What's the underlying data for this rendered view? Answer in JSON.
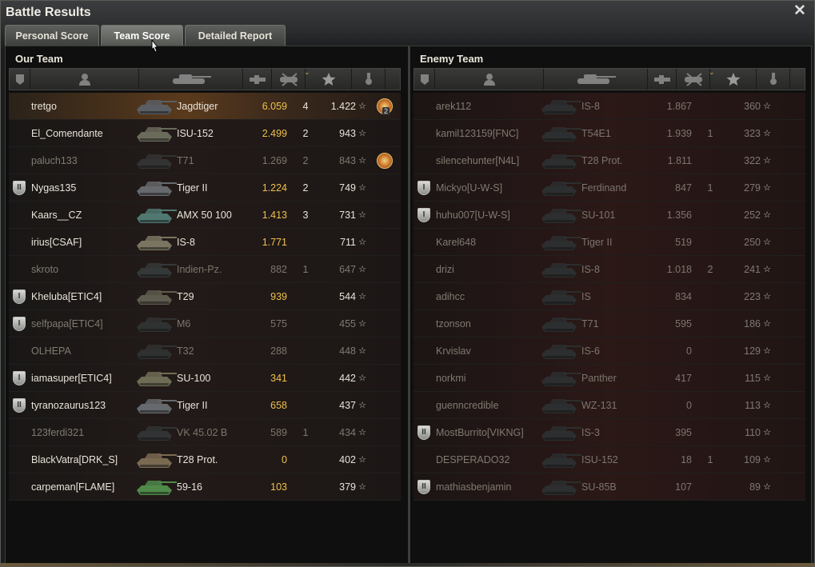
{
  "window": {
    "title": "Battle Results",
    "close_icon": "close-icon"
  },
  "tabs": [
    {
      "label": "Personal Score",
      "active": false
    },
    {
      "label": "Team Score",
      "active": true
    },
    {
      "label": "Detailed Report",
      "active": false
    }
  ],
  "columns": [
    "badge-icon",
    "player-icon",
    "vehicle-icon",
    "damage-icon",
    "kills-icon",
    "xp-star-icon",
    "achievement-icon"
  ],
  "our_team": {
    "title": "Our Team",
    "rows": [
      {
        "badge": "",
        "name": "tretgo",
        "vehicle": "Jagdtiger",
        "damage": "6.059",
        "kills": "4",
        "xp": "1.422",
        "alive": true,
        "me": true,
        "medal": true,
        "medal_count": "2",
        "tank_color": "#5a5e64"
      },
      {
        "badge": "",
        "name": "El_Comendante",
        "vehicle": "ISU-152",
        "damage": "2.499",
        "kills": "2",
        "xp": "943",
        "alive": true,
        "me": false,
        "medal": false,
        "medal_count": "",
        "tank_color": "#6a6b5a"
      },
      {
        "badge": "",
        "name": "paluch133",
        "vehicle": "T71",
        "damage": "1.269",
        "kills": "2",
        "xp": "843",
        "alive": false,
        "me": false,
        "medal": true,
        "medal_count": "",
        "tank_color": "#333"
      },
      {
        "badge": "II",
        "name": "Nygas135",
        "vehicle": "Tiger II",
        "damage": "1.224",
        "kills": "2",
        "xp": "749",
        "alive": true,
        "me": false,
        "medal": false,
        "medal_count": "",
        "tank_color": "#66696d"
      },
      {
        "badge": "",
        "name": "Kaars__CZ",
        "vehicle": "AMX 50 100",
        "damage": "1.413",
        "kills": "3",
        "xp": "731",
        "alive": true,
        "me": false,
        "medal": false,
        "medal_count": "",
        "tank_color": "#4f7870"
      },
      {
        "badge": "",
        "name": "irius[CSAF]",
        "vehicle": "IS-8",
        "damage": "1.771",
        "kills": "",
        "xp": "711",
        "alive": true,
        "me": false,
        "medal": false,
        "medal_count": "",
        "tank_color": "#7a7560"
      },
      {
        "badge": "",
        "name": "skroto",
        "vehicle": "Indien-Pz.",
        "damage": "882",
        "kills": "1",
        "xp": "647",
        "alive": false,
        "me": false,
        "medal": false,
        "medal_count": "",
        "tank_color": "#353838"
      },
      {
        "badge": "I",
        "name": "Kheluba[ETIC4]",
        "vehicle": "T29",
        "damage": "939",
        "kills": "",
        "xp": "544",
        "alive": true,
        "me": false,
        "medal": false,
        "medal_count": "",
        "tank_color": "#5e5c4e"
      },
      {
        "badge": "I",
        "name": "selfpapa[ETIC4]",
        "vehicle": "M6",
        "damage": "575",
        "kills": "",
        "xp": "455",
        "alive": false,
        "me": false,
        "medal": false,
        "medal_count": "",
        "tank_color": "#303232"
      },
      {
        "badge": "",
        "name": "OLHEPA",
        "vehicle": "T32",
        "damage": "288",
        "kills": "",
        "xp": "448",
        "alive": false,
        "me": false,
        "medal": false,
        "medal_count": "",
        "tank_color": "#2f3130"
      },
      {
        "badge": "I",
        "name": "iamasuper[ETIC4]",
        "vehicle": "SU-100",
        "damage": "341",
        "kills": "",
        "xp": "442",
        "alive": true,
        "me": false,
        "medal": false,
        "medal_count": "",
        "tank_color": "#6e6c55"
      },
      {
        "badge": "II",
        "name": "tyranozaurus123",
        "vehicle": "Tiger II",
        "damage": "658",
        "kills": "",
        "xp": "437",
        "alive": true,
        "me": false,
        "medal": false,
        "medal_count": "",
        "tank_color": "#66696d"
      },
      {
        "badge": "",
        "name": "123ferdi321",
        "vehicle": "VK 45.02 B",
        "damage": "589",
        "kills": "1",
        "xp": "434",
        "alive": false,
        "me": false,
        "medal": false,
        "medal_count": "",
        "tank_color": "#313334"
      },
      {
        "badge": "",
        "name": "BlackVatra[DRK_S]",
        "vehicle": "T28 Prot.",
        "damage": "0",
        "kills": "",
        "xp": "402",
        "alive": true,
        "me": false,
        "medal": false,
        "medal_count": "",
        "tank_color": "#7a6a52"
      },
      {
        "badge": "",
        "name": "carpeman[FLAME]",
        "vehicle": "59-16",
        "damage": "103",
        "kills": "",
        "xp": "379",
        "alive": true,
        "me": false,
        "medal": false,
        "medal_count": "",
        "tank_color": "#4f8a4a"
      }
    ]
  },
  "enemy_team": {
    "title": "Enemy Team",
    "rows": [
      {
        "badge": "",
        "name": "arek112",
        "vehicle": "IS-8",
        "damage": "1.867",
        "kills": "",
        "xp": "360",
        "alive": false
      },
      {
        "badge": "",
        "name": "kamil123159[FNC]",
        "vehicle": "T54E1",
        "damage": "1.939",
        "kills": "1",
        "xp": "323",
        "alive": false
      },
      {
        "badge": "",
        "name": "silencehunter[N4L]",
        "vehicle": "T28 Prot.",
        "damage": "1.811",
        "kills": "",
        "xp": "322",
        "alive": false
      },
      {
        "badge": "I",
        "name": "Mickyo[U-W-S]",
        "vehicle": "Ferdinand",
        "damage": "847",
        "kills": "1",
        "xp": "279",
        "alive": false
      },
      {
        "badge": "I",
        "name": "huhu007[U-W-S]",
        "vehicle": "SU-101",
        "damage": "1.356",
        "kills": "",
        "xp": "252",
        "alive": false
      },
      {
        "badge": "",
        "name": "Karel648",
        "vehicle": "Tiger II",
        "damage": "519",
        "kills": "",
        "xp": "250",
        "alive": false
      },
      {
        "badge": "",
        "name": "drizi",
        "vehicle": "IS-8",
        "damage": "1.018",
        "kills": "2",
        "xp": "241",
        "alive": false
      },
      {
        "badge": "",
        "name": "adihcc",
        "vehicle": "IS",
        "damage": "834",
        "kills": "",
        "xp": "223",
        "alive": false
      },
      {
        "badge": "",
        "name": "tzonson",
        "vehicle": "T71",
        "damage": "595",
        "kills": "",
        "xp": "186",
        "alive": false
      },
      {
        "badge": "",
        "name": "Krvislav",
        "vehicle": "IS-6",
        "damage": "0",
        "kills": "",
        "xp": "129",
        "alive": false
      },
      {
        "badge": "",
        "name": "norkmi",
        "vehicle": "Panther",
        "damage": "417",
        "kills": "",
        "xp": "115",
        "alive": false
      },
      {
        "badge": "",
        "name": "guenncredible",
        "vehicle": "WZ-131",
        "damage": "0",
        "kills": "",
        "xp": "113",
        "alive": false
      },
      {
        "badge": "II",
        "name": "MostBurrito[VIKNG]",
        "vehicle": "IS-3",
        "damage": "395",
        "kills": "",
        "xp": "110",
        "alive": false
      },
      {
        "badge": "",
        "name": "DESPERADO32",
        "vehicle": "ISU-152",
        "damage": "18",
        "kills": "1",
        "xp": "109",
        "alive": false
      },
      {
        "badge": "II",
        "name": "mathiasbenjamin",
        "vehicle": "SU-85B",
        "damage": "107",
        "kills": "",
        "xp": "89",
        "alive": false
      }
    ]
  }
}
